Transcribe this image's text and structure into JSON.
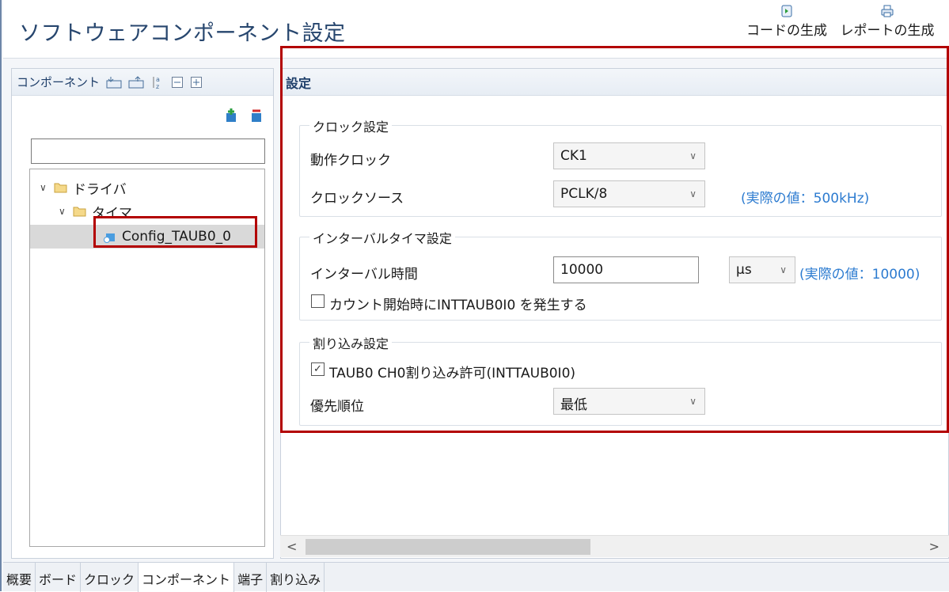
{
  "header": {
    "title": "ソフトウェアコンポーネント設定",
    "generate_code_label": "コードの生成",
    "generate_report_label": "レポートの生成"
  },
  "left_panel": {
    "title": "コンポーネント",
    "search": {
      "value": "",
      "placeholder": ""
    },
    "tree": [
      {
        "label": "ドライバ",
        "level": 0,
        "expanded": true,
        "icon": "folder-icon"
      },
      {
        "label": "タイマ",
        "level": 1,
        "expanded": true,
        "icon": "folder-icon"
      },
      {
        "label": "Config_TAUB0_0",
        "level": 2,
        "selected": true,
        "icon": "component-icon"
      }
    ]
  },
  "settings": {
    "title": "設定",
    "clock": {
      "legend": "クロック設定",
      "operation_clock_label": "動作クロック",
      "operation_clock_value": "CK1",
      "clock_source_label": "クロックソース",
      "clock_source_value": "PCLK/8",
      "clock_source_actual": "(実際の値：500kHz)"
    },
    "interval": {
      "legend": "インターバルタイマ設定",
      "interval_time_label": "インターバル時間",
      "interval_time_value": "10000",
      "unit_value": "μs",
      "actual": "(実際の値：10000)",
      "gen_on_start_label": "カウント開始時にINTTAUB0I0 を発生する",
      "gen_on_start_checked": false
    },
    "interrupt": {
      "legend": "割り込み設定",
      "enable_label": "TAUB0 CH0割り込み許可(INTTAUB0I0)",
      "enable_checked": true,
      "priority_label": "優先順位",
      "priority_value": "最低"
    }
  },
  "bottom_tabs": [
    "概要",
    "ボード",
    "クロック",
    "コンポーネント",
    "端子",
    "割り込み"
  ],
  "active_tab": "コンポーネント",
  "colors": {
    "title": "#27466e",
    "actual_value": "#2c7bd0",
    "highlight": "#b30000"
  }
}
